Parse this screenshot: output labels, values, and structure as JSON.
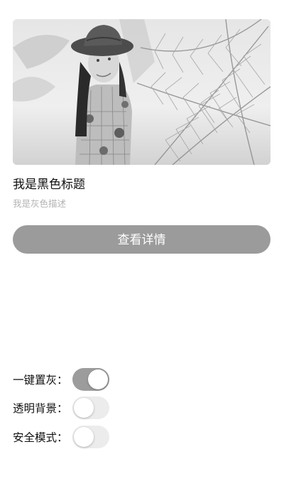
{
  "card": {
    "image_description": "",
    "title": "我是黑色标题",
    "description": "我是灰色描述",
    "button_label": "查看详情"
  },
  "settings": {
    "items": [
      {
        "label": "一键置灰：",
        "on": true
      },
      {
        "label": "透明背景：",
        "on": false
      },
      {
        "label": "安全模式：",
        "on": false
      }
    ]
  },
  "colors": {
    "button_bg": "#9b9b9b",
    "switch_on": "#9c9c9c",
    "switch_off": "#ececec",
    "title_text": "#111111",
    "desc_text": "#b3b3b3"
  }
}
